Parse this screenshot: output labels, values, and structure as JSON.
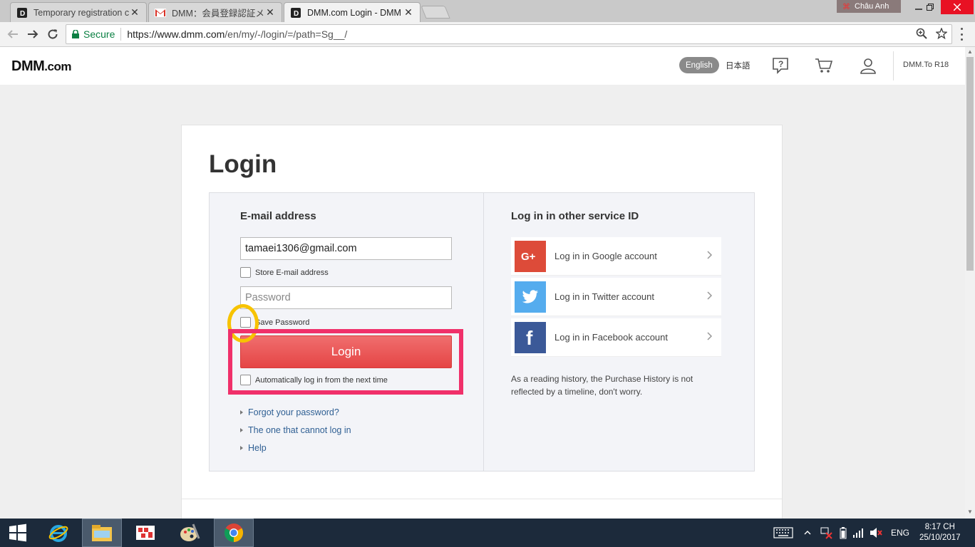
{
  "browser": {
    "tabs": [
      {
        "title": "Temporary registration c",
        "favicon": "dmm-favicon",
        "active": false
      },
      {
        "title": "DMM：会員登録認証メ",
        "favicon": "gmail-favicon",
        "active": false
      },
      {
        "title": "DMM.com Login - DMM",
        "favicon": "dmm-favicon",
        "active": true
      }
    ],
    "tab_close": "✕",
    "profile_name": "Châu Anh",
    "secure_label": "Secure",
    "url_host": "https://www.dmm.com",
    "url_path": "/en/my/-/login/=/path=Sg__/"
  },
  "site": {
    "logo_main": "DMM",
    "logo_suffix": ".com",
    "lang_english": "English",
    "lang_japanese": "日本語",
    "r18_link": "DMM.To R18"
  },
  "login": {
    "title": "Login",
    "email_section": "E-mail address",
    "email_value": "tamaei1306@gmail.com",
    "store_email_label": "Store E-mail address",
    "password_placeholder": "Password",
    "save_password_label": "Save Password",
    "login_button": "Login",
    "auto_login_label": "Automatically log in from the next time",
    "links": [
      "Forgot your password?",
      "The one that cannot log in",
      "Help"
    ]
  },
  "other_service": {
    "title": "Log in in other service ID",
    "providers": [
      {
        "label": "Log in in Google account",
        "icon": "google-plus-icon",
        "color": "#dd4b39"
      },
      {
        "label": "Log in in Twitter account",
        "icon": "twitter-icon",
        "color": "#55acee"
      },
      {
        "label": "Log in in Facebook account",
        "icon": "facebook-icon",
        "color": "#3b5998"
      }
    ],
    "note": "As a reading history, the Purchase History is not reflected by a timeline, don't worry."
  },
  "taskbar": {
    "language": "ENG",
    "time": "8:17 CH",
    "date": "25/10/2017"
  },
  "colors": {
    "login_button": "#e54545",
    "annotation_circle": "#f7c300",
    "annotation_rect": "#f0306a",
    "link": "#2f5f93"
  }
}
